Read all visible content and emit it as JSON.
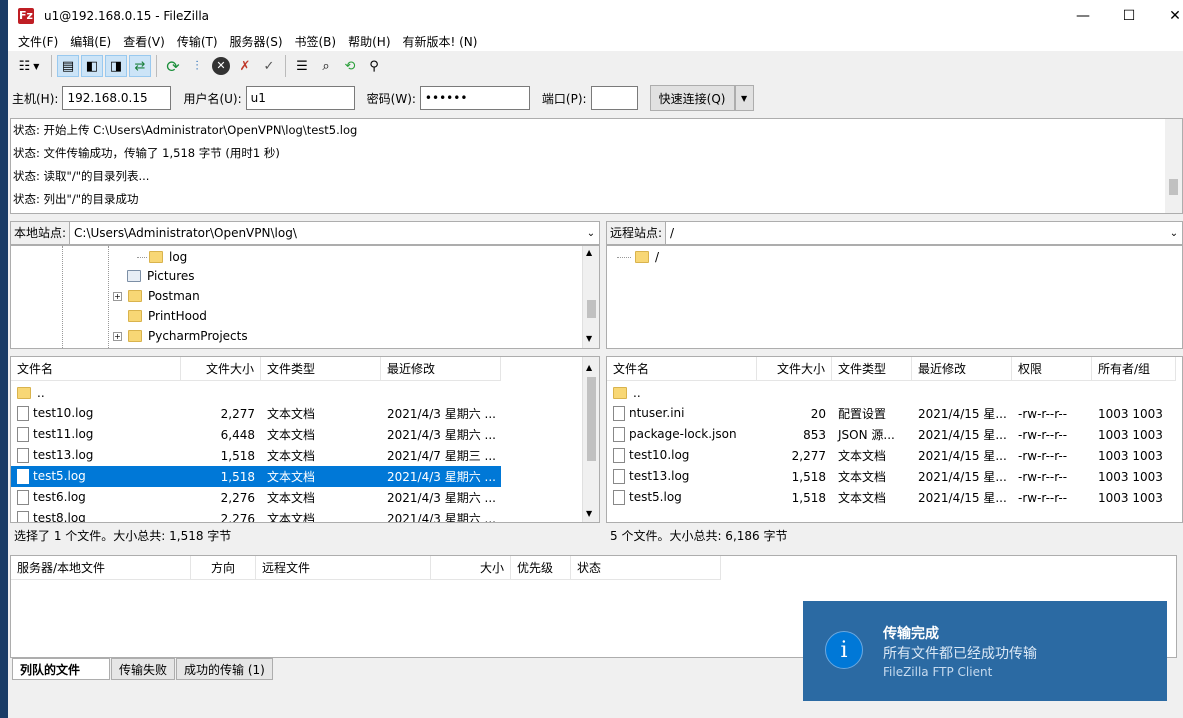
{
  "window": {
    "title": "u1@192.168.0.15 - FileZilla",
    "app_icon": "Fz",
    "min": "—",
    "max": "☐",
    "close": "✕"
  },
  "menu": [
    "文件(F)",
    "编辑(E)",
    "查看(V)",
    "传输(T)",
    "服务器(S)",
    "书签(B)",
    "帮助(H)",
    "有新版本! (N)"
  ],
  "toolbar": {
    "icons": [
      "site-manager-icon",
      "toggle-log-icon",
      "toggle-local-tree-icon",
      "toggle-remote-tree-icon",
      "toggle-queue-icon",
      "refresh-icon",
      "process-queue-icon",
      "cancel-icon",
      "disconnect-icon",
      "reconnect-icon",
      "filter-icon",
      "search-icon",
      "sync-browse-icon",
      "find-files-icon"
    ]
  },
  "quickconnect": {
    "host_label": "主机(H):",
    "host": "192.168.0.15",
    "user_label": "用户名(U):",
    "user": "u1",
    "pass_label": "密码(W):",
    "pass": "••••••",
    "port_label": "端口(P):",
    "port": "",
    "button": "快速连接(Q)",
    "dropdown": "▼"
  },
  "log": [
    "状态:  开始上传 C:\\Users\\Administrator\\OpenVPN\\log\\test5.log",
    "状态:  文件传输成功，传输了 1,518 字节 (用时1 秒)",
    "状态:  读取\"/\"的目录列表...",
    "状态:  列出\"/\"的目录成功"
  ],
  "local": {
    "site_label": "本地站点:",
    "path": "C:\\Users\\Administrator\\OpenVPN\\log\\",
    "tree": [
      {
        "name": "log",
        "expander": ""
      },
      {
        "name": "Pictures",
        "expander": ""
      },
      {
        "name": "Postman",
        "expander": "+"
      },
      {
        "name": "PrintHood",
        "expander": ""
      },
      {
        "name": "PycharmProjects",
        "expander": "+"
      }
    ],
    "columns": [
      "文件名",
      "文件大小",
      "文件类型",
      "最近修改"
    ],
    "files": [
      {
        "name": "..",
        "size": "",
        "type": "",
        "modified": ""
      },
      {
        "name": "test10.log",
        "size": "2,277",
        "type": "文本文档",
        "modified": "2021/4/3 星期六 ..."
      },
      {
        "name": "test11.log",
        "size": "6,448",
        "type": "文本文档",
        "modified": "2021/4/3 星期六 ..."
      },
      {
        "name": "test13.log",
        "size": "1,518",
        "type": "文本文档",
        "modified": "2021/4/7 星期三 ..."
      },
      {
        "name": "test5.log",
        "size": "1,518",
        "type": "文本文档",
        "modified": "2021/4/3 星期六 ..."
      },
      {
        "name": "test6.log",
        "size": "2,276",
        "type": "文本文档",
        "modified": "2021/4/3 星期六 ..."
      },
      {
        "name": "test8.log",
        "size": "2,276",
        "type": "文本文档",
        "modified": "2021/4/3 星期六 ..."
      }
    ],
    "status": "选择了 1 个文件。大小总共: 1,518 字节"
  },
  "remote": {
    "site_label": "远程站点:",
    "path": "/",
    "tree": [
      {
        "name": "/"
      }
    ],
    "columns": [
      "文件名",
      "文件大小",
      "文件类型",
      "最近修改",
      "权限",
      "所有者/组"
    ],
    "files": [
      {
        "name": "..",
        "size": "",
        "type": "",
        "modified": "",
        "perm": "",
        "owner": ""
      },
      {
        "name": "ntuser.ini",
        "size": "20",
        "type": "配置设置",
        "modified": "2021/4/15 星...",
        "perm": "-rw-r--r--",
        "owner": "1003 1003"
      },
      {
        "name": "package-lock.json",
        "size": "853",
        "type": "JSON 源...",
        "modified": "2021/4/15 星...",
        "perm": "-rw-r--r--",
        "owner": "1003 1003"
      },
      {
        "name": "test10.log",
        "size": "2,277",
        "type": "文本文档",
        "modified": "2021/4/15 星...",
        "perm": "-rw-r--r--",
        "owner": "1003 1003"
      },
      {
        "name": "test13.log",
        "size": "1,518",
        "type": "文本文档",
        "modified": "2021/4/15 星...",
        "perm": "-rw-r--r--",
        "owner": "1003 1003"
      },
      {
        "name": "test5.log",
        "size": "1,518",
        "type": "文本文档",
        "modified": "2021/4/15 星...",
        "perm": "-rw-r--r--",
        "owner": "1003 1003"
      }
    ],
    "status": "5 个文件。大小总共: 6,186 字节"
  },
  "queue": {
    "columns": [
      "服务器/本地文件",
      "方向",
      "远程文件",
      "大小",
      "优先级",
      "状态"
    ],
    "tabs": [
      "列队的文件",
      "传输失败",
      "成功的传输 (1)"
    ]
  },
  "toast": {
    "icon": "i",
    "title": "传输完成",
    "message": "所有文件都已经成功传输",
    "source": "FileZilla FTP Client"
  }
}
